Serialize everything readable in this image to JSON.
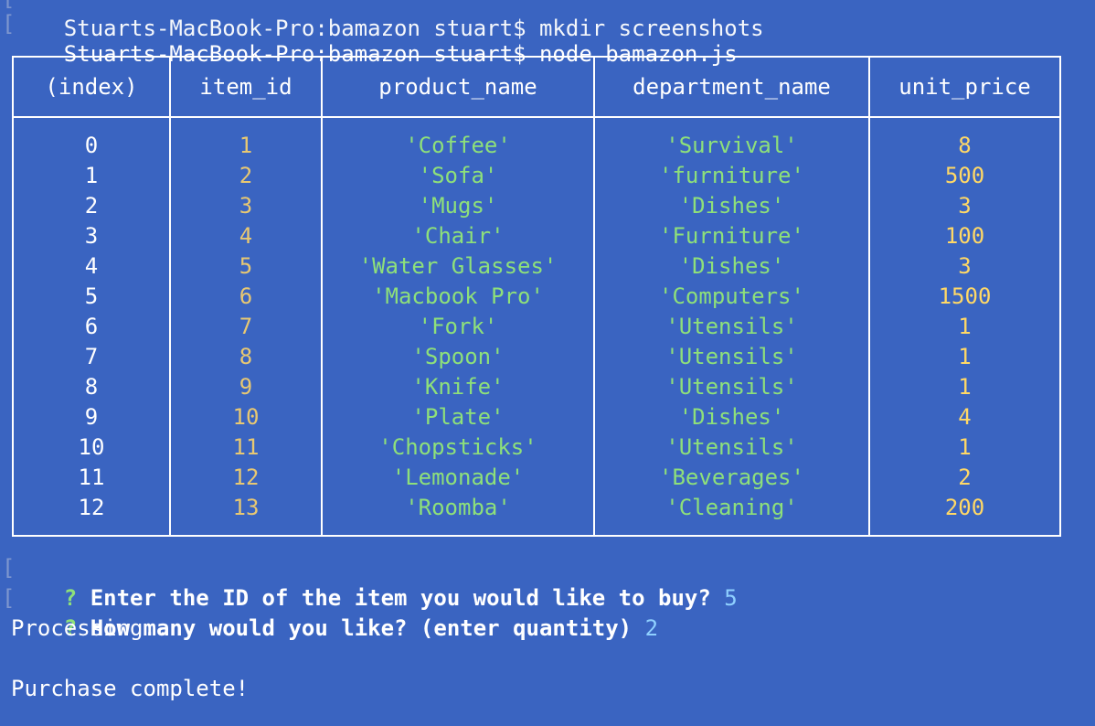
{
  "terminal": {
    "previous_command": "Stuarts-MacBook-Pro:bamazon stuart$ mkdir screenshots",
    "command_line": "Stuarts-MacBook-Pro:bamazon stuart$ node bamazon.js"
  },
  "table": {
    "headers": [
      "(index)",
      "item_id",
      "product_name",
      "department_name",
      "unit_price"
    ],
    "rows": [
      {
        "index": "0",
        "item_id": "1",
        "product_name": "'Coffee'",
        "department_name": "'Survival'",
        "unit_price": "8"
      },
      {
        "index": "1",
        "item_id": "2",
        "product_name": "'Sofa'",
        "department_name": "'furniture'",
        "unit_price": "500"
      },
      {
        "index": "2",
        "item_id": "3",
        "product_name": "'Mugs'",
        "department_name": "'Dishes'",
        "unit_price": "3"
      },
      {
        "index": "3",
        "item_id": "4",
        "product_name": "'Chair'",
        "department_name": "'Furniture'",
        "unit_price": "100"
      },
      {
        "index": "4",
        "item_id": "5",
        "product_name": "'Water Glasses'",
        "department_name": "'Dishes'",
        "unit_price": "3"
      },
      {
        "index": "5",
        "item_id": "6",
        "product_name": "'Macbook Pro'",
        "department_name": "'Computers'",
        "unit_price": "1500"
      },
      {
        "index": "6",
        "item_id": "7",
        "product_name": "'Fork'",
        "department_name": "'Utensils'",
        "unit_price": "1"
      },
      {
        "index": "7",
        "item_id": "8",
        "product_name": "'Spoon'",
        "department_name": "'Utensils'",
        "unit_price": "1"
      },
      {
        "index": "8",
        "item_id": "9",
        "product_name": "'Knife'",
        "department_name": "'Utensils'",
        "unit_price": "1"
      },
      {
        "index": "9",
        "item_id": "10",
        "product_name": "'Plate'",
        "department_name": "'Dishes'",
        "unit_price": "4"
      },
      {
        "index": "10",
        "item_id": "11",
        "product_name": "'Chopsticks'",
        "department_name": "'Utensils'",
        "unit_price": "1"
      },
      {
        "index": "11",
        "item_id": "12",
        "product_name": "'Lemonade'",
        "department_name": "'Beverages'",
        "unit_price": "2"
      },
      {
        "index": "12",
        "item_id": "13",
        "product_name": "'Roomba'",
        "department_name": "'Cleaning'",
        "unit_price": "200"
      }
    ]
  },
  "prompts": [
    {
      "mark": "?",
      "question": "Enter the ID of the item you would like to buy?",
      "answer": "5"
    },
    {
      "mark": "?",
      "question": "How many would you like? (enter quantity)",
      "answer": "2"
    }
  ],
  "output": {
    "processing": "Processing..",
    "complete": "Purchase complete!"
  },
  "colors": {
    "background": "#3a64c1",
    "string_value": "#8ee07a",
    "number_value": "#ffd866",
    "answer": "#8fd0ff"
  }
}
